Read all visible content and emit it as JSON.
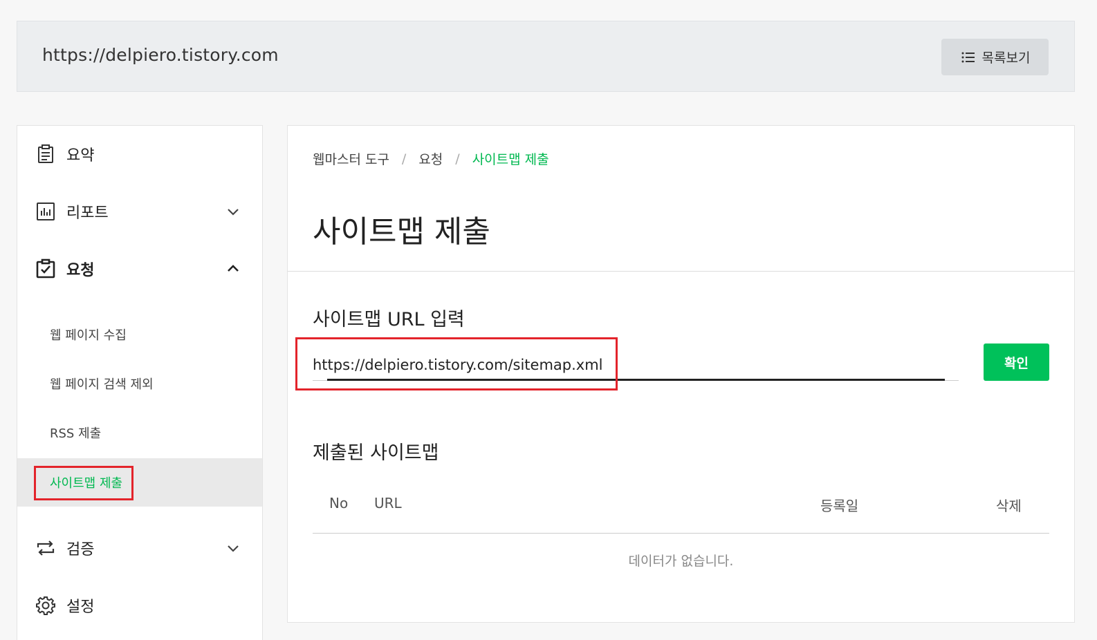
{
  "header": {
    "site_url": "https://delpiero.tistory.com",
    "list_button_label": "목록보기",
    "list_icon": "list-icon"
  },
  "sidebar": {
    "items": [
      {
        "label": "요약",
        "icon": "clipboard-icon"
      },
      {
        "label": "리포트",
        "icon": "bar-chart-icon",
        "expanded": false
      },
      {
        "label": "요청",
        "icon": "clipboard-check-icon",
        "expanded": true
      },
      {
        "label": "검증",
        "icon": "repeat-icon",
        "expanded": false
      },
      {
        "label": "설정",
        "icon": "gear-icon"
      }
    ],
    "request_submenu": [
      {
        "label": "웹 페이지 수집"
      },
      {
        "label": "웹 페이지 검색 제외"
      },
      {
        "label": "RSS 제출"
      },
      {
        "label": "사이트맵 제출",
        "active": true
      }
    ]
  },
  "main": {
    "breadcrumb": [
      "웹마스터 도구",
      "요청",
      "사이트맵 제출"
    ],
    "page_title": "사이트맵 제출",
    "input_section_label": "사이트맵 URL 입력",
    "sitemap_url_value": "https://delpiero.tistory.com/sitemap.xml",
    "confirm_label": "확인",
    "submitted_section_label": "제출된 사이트맵",
    "table": {
      "columns": [
        "No",
        "URL",
        "등록일",
        "삭제"
      ],
      "rows": [],
      "empty_message": "데이터가 없습니다."
    }
  },
  "colors": {
    "accent": "#00c15a",
    "highlight_box": "#e3242b"
  }
}
